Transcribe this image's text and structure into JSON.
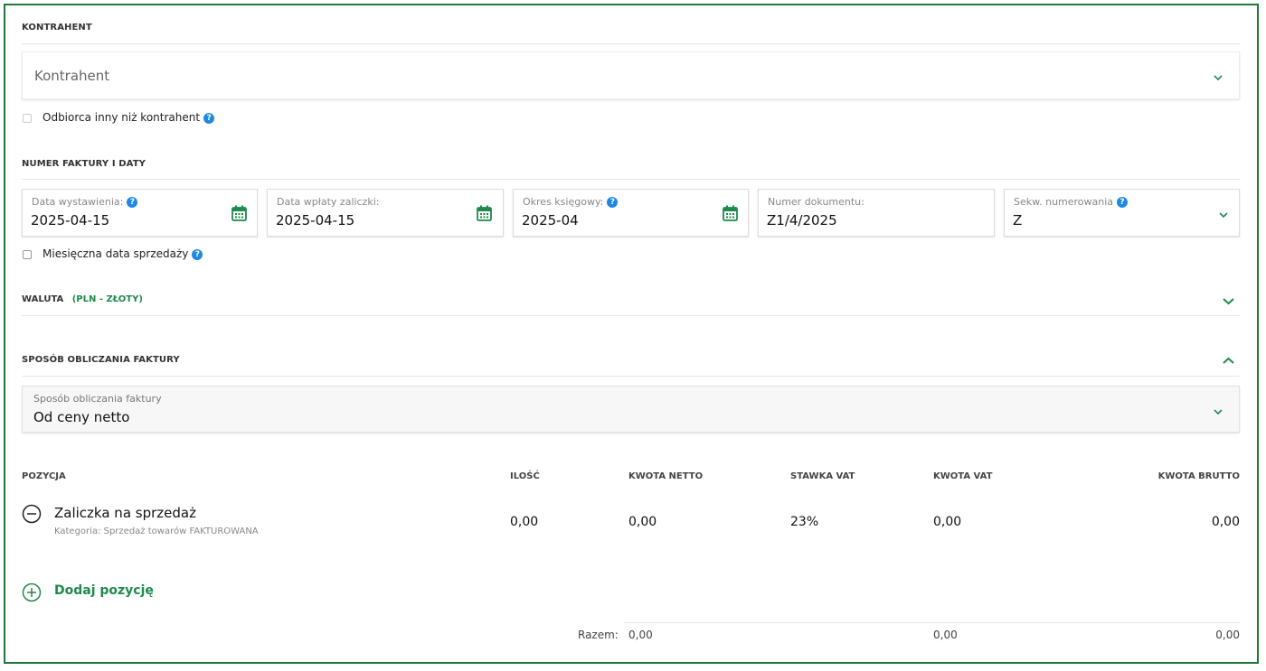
{
  "contractor": {
    "section_title": "KONTRAHENT",
    "select_placeholder": "Kontrahent",
    "recipient_checkbox_label": "Odbiorca inny niż kontrahent"
  },
  "invoice_dates": {
    "section_title": "NUMER FAKTURY I DATY",
    "issue_date_label": "Data wystawienia:",
    "issue_date_value": "2025-04-15",
    "advance_date_label": "Data wpłaty zaliczki:",
    "advance_date_value": "2025-04-15",
    "period_label": "Okres księgowy:",
    "period_value": "2025-04",
    "doc_number_label": "Numer dokumentu:",
    "doc_number_value": "Z1/4/2025",
    "sequence_label": "Sekw. numerowania",
    "sequence_value": "Z",
    "monthly_checkbox_label": "Miesięczna data sprzedaży"
  },
  "currency": {
    "section_title": "WALUTA",
    "value": "(PLN - ZŁOTY)"
  },
  "calc_method": {
    "section_title": "SPOSÓB OBLICZANIA FAKTURY",
    "field_label": "Sposób obliczania faktury",
    "field_value": "Od ceny netto"
  },
  "table": {
    "headers": {
      "position": "POZYCJA",
      "qty": "ILOŚĆ",
      "net": "KWOTA NETTO",
      "vat_rate": "STAWKA VAT",
      "vat_amount": "KWOTA VAT",
      "gross": "KWOTA BRUTTO"
    },
    "rows": [
      {
        "name": "Zaliczka na sprzedaż",
        "category": "Kategoria: Sprzedaż towarów FAKTUROWANA",
        "qty": "0,00",
        "net": "0,00",
        "vat_rate": "23%",
        "vat_amount": "0,00",
        "gross": "0,00"
      }
    ],
    "add_label": "Dodaj pozycję",
    "totals": {
      "label": "Razem:",
      "net": "0,00",
      "vat_amount": "0,00",
      "gross": "0,00"
    }
  },
  "colors": {
    "accent_green": "#1e8a4c",
    "help_blue": "#1e88e5",
    "frame_green": "#1e7a3a"
  }
}
